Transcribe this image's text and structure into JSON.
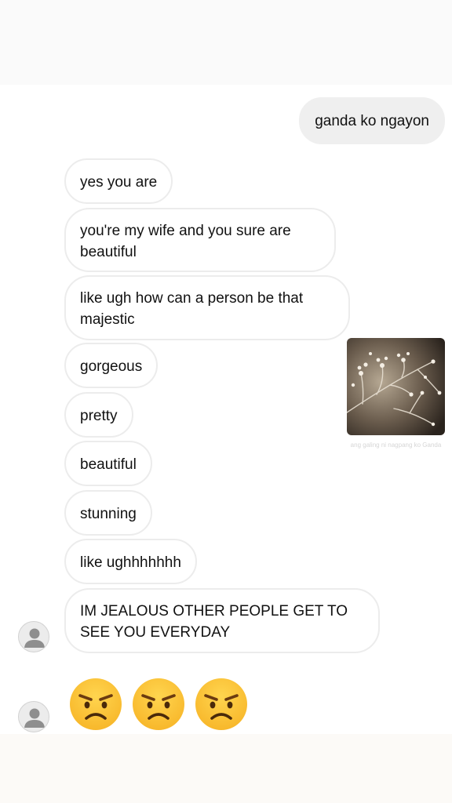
{
  "conversation": {
    "outgoing": [
      {
        "text": "ganda ko ngayon"
      }
    ],
    "incoming": [
      {
        "text": "yes you are"
      },
      {
        "text": "you're my wife and you sure are beautiful"
      },
      {
        "text": "like ugh how can a person be that majestic"
      },
      {
        "text": "gorgeous"
      },
      {
        "text": "pretty"
      },
      {
        "text": "beautiful"
      },
      {
        "text": "stunning"
      },
      {
        "text": "like ughhhhhhh"
      },
      {
        "text": "IM JEALOUS OTHER PEOPLE GET TO SEE YOU EVERYDAY"
      }
    ],
    "shared_photo": {
      "caption": "ang galing ni nagpang ko Ganda"
    },
    "emoji_message": {
      "emojis": [
        "angry-face",
        "angry-face",
        "angry-face"
      ]
    }
  },
  "colors": {
    "incoming_bubble_border": "#ececec",
    "outgoing_bubble_bg": "#efefef",
    "emoji_face": "#f7b528"
  }
}
